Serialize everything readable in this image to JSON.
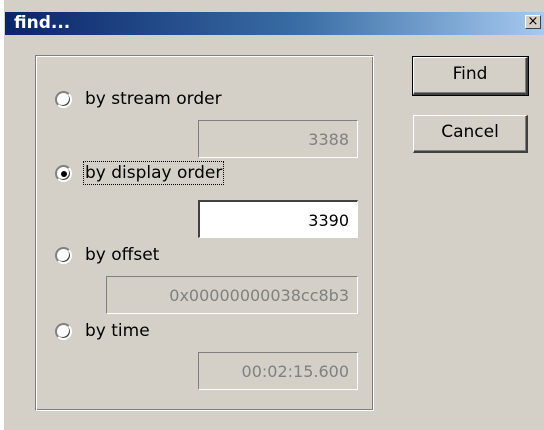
{
  "window": {
    "title": "find...",
    "close_glyph": "×"
  },
  "options": [
    {
      "label": "by stream order",
      "selected": false,
      "value": "3388",
      "active": false
    },
    {
      "label": "by display order",
      "selected": true,
      "value": "3390",
      "active": true
    },
    {
      "label": "by offset",
      "selected": false,
      "value": "0x00000000038cc8b3",
      "active": false
    },
    {
      "label": "by time",
      "selected": false,
      "value": "00:02:15.600",
      "active": false
    }
  ],
  "buttons": {
    "find_label": "Find",
    "cancel_label": "Cancel"
  },
  "colors": {
    "dialog_bg": "#d4d0c8",
    "title_start": "#0a246a",
    "title_end": "#a6caf0",
    "disabled_text": "#808080"
  }
}
